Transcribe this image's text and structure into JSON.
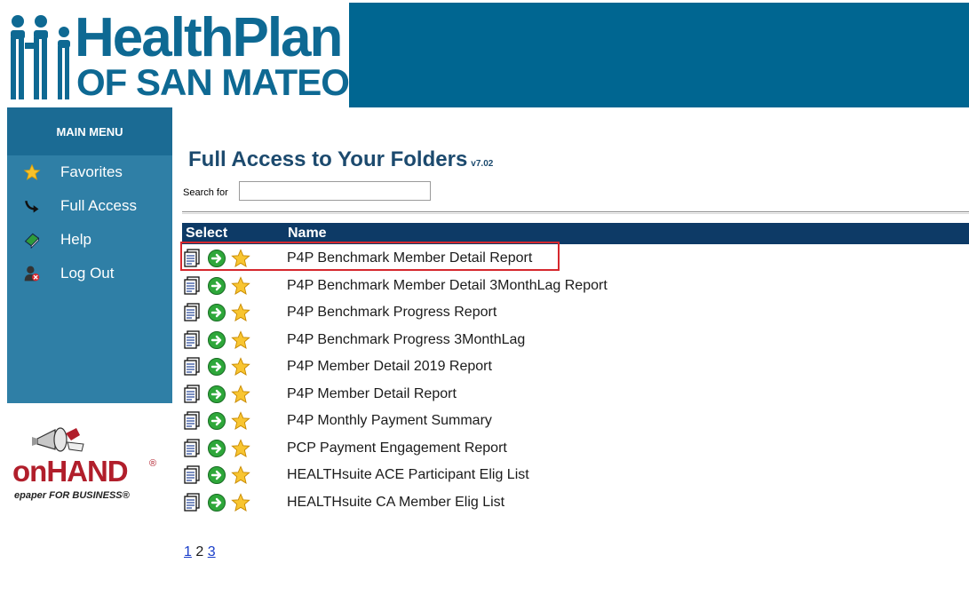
{
  "header": {
    "logo_line1": "HealthPlan",
    "logo_line2": "OF SAN MATEO"
  },
  "sidebar": {
    "title": "MAIN MENU",
    "items": [
      {
        "label": "Favorites",
        "icon": "star-icon"
      },
      {
        "label": "Full Access",
        "icon": "arrow-curve-icon"
      },
      {
        "label": "Help",
        "icon": "book-icon"
      },
      {
        "label": "Log Out",
        "icon": "user-logout-icon"
      }
    ]
  },
  "branding": {
    "onhand_word": "onHAND",
    "onhand_reg": "®",
    "onhand_tagline": "epaper FOR BUSINESS®"
  },
  "main": {
    "title": "Full Access to Your Folders",
    "version": "v7.02",
    "search_label": "Search for",
    "search_value": "",
    "columns": {
      "select": "Select",
      "name": "Name"
    },
    "rows": [
      {
        "name": "P4P Benchmark Member Detail Report"
      },
      {
        "name": "P4P Benchmark Member Detail 3MonthLag Report"
      },
      {
        "name": "P4P Benchmark Progress Report"
      },
      {
        "name": "P4P Benchmark Progress 3MonthLag"
      },
      {
        "name": "P4P Member Detail 2019 Report"
      },
      {
        "name": "P4P Member Detail Report"
      },
      {
        "name": "P4P Monthly Payment Summary"
      },
      {
        "name": "PCP Payment Engagement Report"
      },
      {
        "name": "HEALTHsuite ACE Participant Elig List"
      },
      {
        "name": "HEALTHsuite CA Member Elig List"
      }
    ],
    "pager": {
      "pages": [
        "1",
        "2",
        "3"
      ],
      "current": "2"
    }
  },
  "colors": {
    "brand_blue": "#006691",
    "sidebar_blue": "#2f7fa6",
    "table_header": "#0d3a66",
    "highlight_red": "#d6282e",
    "onhand_red": "#b11e2b"
  }
}
